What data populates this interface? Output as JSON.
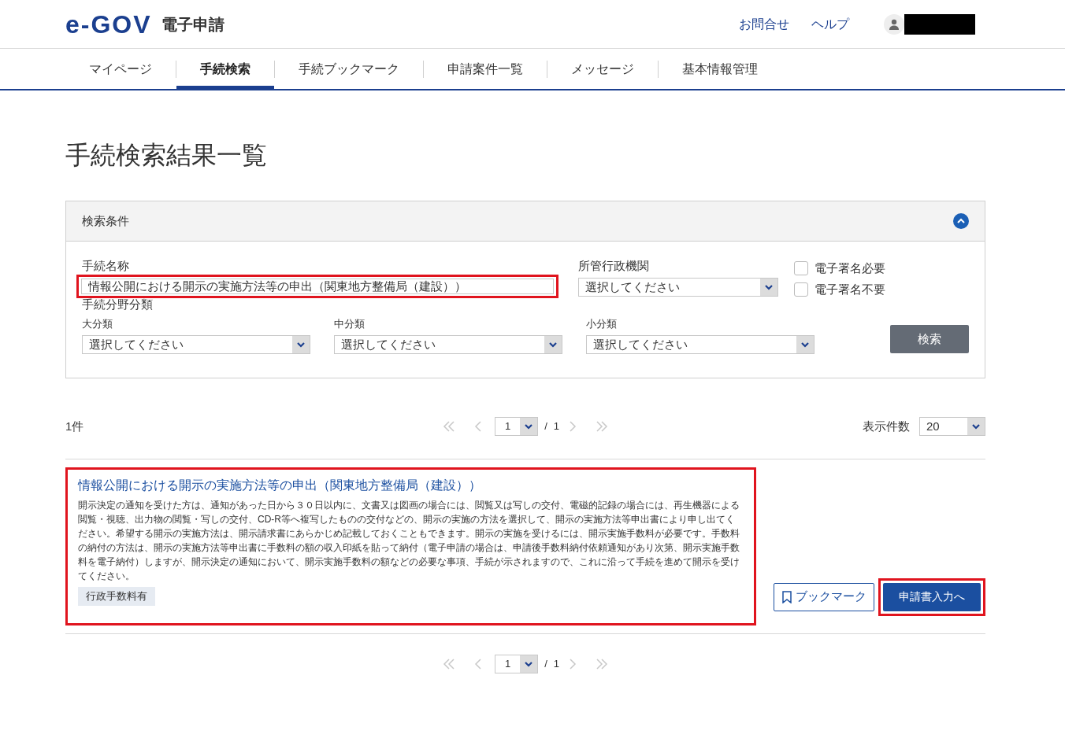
{
  "header": {
    "logo": "e-GOV",
    "service": "電子申請",
    "links": [
      "お問合せ",
      "ヘルプ"
    ],
    "user_redacted": true
  },
  "tabs": [
    {
      "label": "マイページ",
      "selected": false
    },
    {
      "label": "手続検索",
      "selected": true
    },
    {
      "label": "手続ブックマーク",
      "selected": false
    },
    {
      "label": "申請案件一覧",
      "selected": false
    },
    {
      "label": "メッセージ",
      "selected": false
    },
    {
      "label": "基本情報管理",
      "selected": false
    }
  ],
  "page_title": "手続検索結果一覧",
  "search_panel": {
    "title": "検索条件",
    "expanded": true,
    "procedure_name": {
      "label": "手続名称",
      "value": "情報公開における開示の実施方法等の申出（関東地方整備局（建設））",
      "highlighted": true
    },
    "agency": {
      "label": "所管行政機関",
      "value": "選択してください"
    },
    "checkboxes": [
      {
        "label": "電子署名必要",
        "checked": false
      },
      {
        "label": "電子署名不要",
        "checked": false
      }
    ],
    "category_label": "手続分野分類",
    "categories": [
      {
        "label": "大分類",
        "value": "選択してください"
      },
      {
        "label": "中分類",
        "value": "選択してください"
      },
      {
        "label": "小分類",
        "value": "選択してください"
      }
    ],
    "search_button": "検索"
  },
  "result_count": "1件",
  "pager_top": {
    "page": "1",
    "separator": "/",
    "total": "1"
  },
  "page_size": {
    "label": "表示件数",
    "value": "20"
  },
  "results": [
    {
      "title": "情報公開における開示の実施方法等の申出（関東地方整備局（建設））",
      "description": "開示決定の通知を受けた方は、通知があった日から３０日以内に、文書又は図画の場合には、閲覧又は写しの交付、電磁的記録の場合には、再生機器による閲覧・視聴、出力物の閲覧・写しの交付、CD-R等へ複写したものの交付などの、開示の実施の方法を選択して、開示の実施方法等申出書により申し出てください。希望する開示の実施方法は、開示請求書にあらかじめ記載しておくこともできます。開示の実施を受けるには、開示実施手数料が必要です。手数料の納付の方法は、開示の実施方法等申出書に手数料の額の収入印紙を貼って納付（電子申請の場合は、申請後手数料納付依頼通知があり次第、開示実施手数料を電子納付）しますが、開示決定の通知において、開示実施手数料の額などの必要な事項、手続が示されますので、これに沿って手続を進めて開示を受けてください。",
      "tags": [
        "行政手数料有"
      ],
      "highlighted": true,
      "bookmark_button": "ブックマーク",
      "apply_button": "申請書入力へ",
      "apply_highlighted": true
    }
  ],
  "pager_bottom": {
    "page": "1",
    "separator": "/",
    "total": "1"
  }
}
